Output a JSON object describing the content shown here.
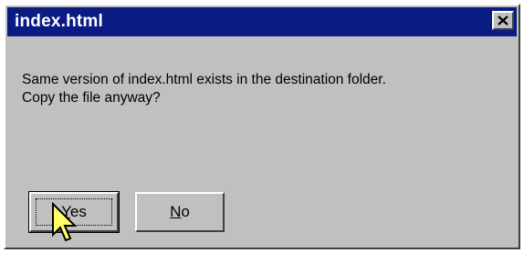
{
  "window": {
    "title": "index.html",
    "close_icon": "close-x-icon"
  },
  "message": {
    "line1": "Same version of index.html exists in the destination folder.",
    "line2": "Copy the file anyway?"
  },
  "buttons": {
    "yes_label": "Yes",
    "no_label": "No"
  },
  "colors": {
    "titlebar": "#0a1c84",
    "face": "#c0c0c0",
    "cursor_fill": "#ffff66"
  },
  "cursor_icon": "arrow-pointer-icon"
}
